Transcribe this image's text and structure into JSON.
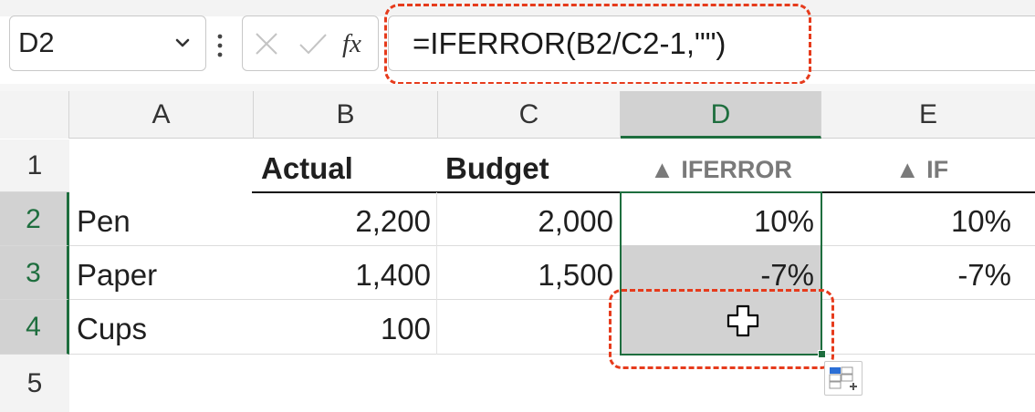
{
  "name_box": {
    "value": "D2"
  },
  "formula_bar": {
    "fx_label": "fx",
    "formula": "=IFERROR(B2/C2-1,\"\")"
  },
  "columns": [
    "A",
    "B",
    "C",
    "D",
    "E"
  ],
  "selected_column": "D",
  "rows": [
    "1",
    "2",
    "3",
    "4",
    "5"
  ],
  "cells": {
    "B1": "Actual",
    "C1": "Budget",
    "D1": "▲ IFERROR",
    "E1": "▲ IF",
    "A2": "Pen",
    "B2": "2,200",
    "C2": "2,000",
    "D2": "10%",
    "E2": "10%",
    "A3": "Paper",
    "B3": "1,400",
    "C3": "1,500",
    "D3": "-7%",
    "E3": "-7%",
    "A4": "Cups",
    "B4": "100"
  },
  "colors": {
    "selection": "#1e6e3e",
    "highlight": "#e63b1c",
    "selected_fill": "#d2d2d2"
  }
}
